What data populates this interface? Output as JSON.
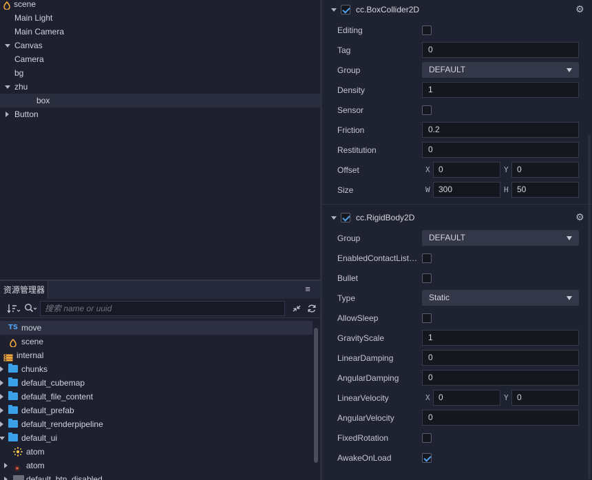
{
  "hierarchy": {
    "items": [
      {
        "label": "scene",
        "level": 0,
        "icon": "scene-icon",
        "expanded": null,
        "selected": false
      },
      {
        "label": "Main Light",
        "level": 1,
        "expanded": null,
        "selected": false
      },
      {
        "label": "Main Camera",
        "level": 1,
        "expanded": null,
        "selected": false
      },
      {
        "label": "Canvas",
        "level": 1,
        "expanded": true,
        "selected": false
      },
      {
        "label": "Camera",
        "level": 2,
        "expanded": null,
        "selected": false
      },
      {
        "label": "bg",
        "level": 2,
        "expanded": null,
        "selected": false
      },
      {
        "label": "zhu",
        "level": 2,
        "expanded": true,
        "selected": false
      },
      {
        "label": "box",
        "level": 3,
        "expanded": null,
        "selected": true
      },
      {
        "label": "Button",
        "level": 2,
        "expanded": false,
        "selected": false
      }
    ]
  },
  "assets": {
    "tab_label": "资源管理器",
    "menu_icon": "hamburger-icon",
    "search_placeholder": "搜索 name or uuid",
    "items": [
      {
        "label": "move",
        "icon": "ts-icon",
        "icon_text": "TS",
        "indent": 1,
        "expanded": null,
        "selected": true
      },
      {
        "label": "scene",
        "icon": "scene-icon",
        "indent": 1,
        "expanded": null,
        "selected": false
      },
      {
        "label": "internal",
        "icon": "database-icon",
        "indent": 0,
        "expanded": null,
        "selected": false
      },
      {
        "label": "chunks",
        "icon": "folder-icon",
        "indent": 1,
        "expanded": false,
        "selected": false
      },
      {
        "label": "default_cubemap",
        "icon": "folder-icon",
        "indent": 1,
        "expanded": false,
        "selected": false
      },
      {
        "label": "default_file_content",
        "icon": "folder-icon",
        "indent": 1,
        "expanded": false,
        "selected": false
      },
      {
        "label": "default_prefab",
        "icon": "folder-icon",
        "indent": 1,
        "expanded": false,
        "selected": false
      },
      {
        "label": "default_renderpipeline",
        "icon": "folder-icon",
        "indent": 1,
        "expanded": false,
        "selected": false
      },
      {
        "label": "default_ui",
        "icon": "folder-icon",
        "indent": 1,
        "expanded": true,
        "selected": false
      },
      {
        "label": "atom",
        "icon": "particle-icon",
        "indent": 2,
        "expanded": null,
        "selected": false
      },
      {
        "label": "atom",
        "icon": "particle-sprite-icon",
        "indent": 2,
        "expanded": false,
        "selected": false
      },
      {
        "label": "default_btn_disabled",
        "icon": "image-icon",
        "indent": 2,
        "expanded": false,
        "selected": false
      }
    ]
  },
  "inspector": {
    "box_collider": {
      "title": "cc.BoxCollider2D",
      "enabled": true,
      "editing_label": "Editing",
      "editing": false,
      "tag_label": "Tag",
      "tag": "0",
      "group_label": "Group",
      "group": "DEFAULT",
      "density_label": "Density",
      "density": "1",
      "sensor_label": "Sensor",
      "sensor": false,
      "friction_label": "Friction",
      "friction": "0.2",
      "restitution_label": "Restitution",
      "restitution": "0",
      "offset_label": "Offset",
      "offset_x_label": "X",
      "offset_x": "0",
      "offset_y_label": "Y",
      "offset_y": "0",
      "size_label": "Size",
      "size_w_label": "W",
      "size_w": "300",
      "size_h_label": "H",
      "size_h": "50"
    },
    "rigid_body": {
      "title": "cc.RigidBody2D",
      "enabled": true,
      "group_label": "Group",
      "group": "DEFAULT",
      "contact_label": "EnabledContactListener",
      "contact": false,
      "bullet_label": "Bullet",
      "bullet": false,
      "type_label": "Type",
      "type": "Static",
      "allowsleep_label": "AllowSleep",
      "allowsleep": false,
      "gravity_label": "GravityScale",
      "gravity": "1",
      "lineardamp_label": "LinearDamping",
      "lineardamp": "0",
      "angulardamp_label": "AngularDamping",
      "angulardamp": "0",
      "linearvel_label": "LinearVelocity",
      "linearvel_x_label": "X",
      "linearvel_x": "0",
      "linearvel_y_label": "Y",
      "linearvel_y": "0",
      "angularvel_label": "AngularVelocity",
      "angularvel": "0",
      "fixedrot_label": "FixedRotation",
      "fixedrot": false,
      "awake_label": "AwakeOnLoad",
      "awake": true
    }
  },
  "colors": {
    "accent": "#4fa3f0",
    "folder": "#3aa1e8",
    "selection": "#2a2d3d"
  }
}
